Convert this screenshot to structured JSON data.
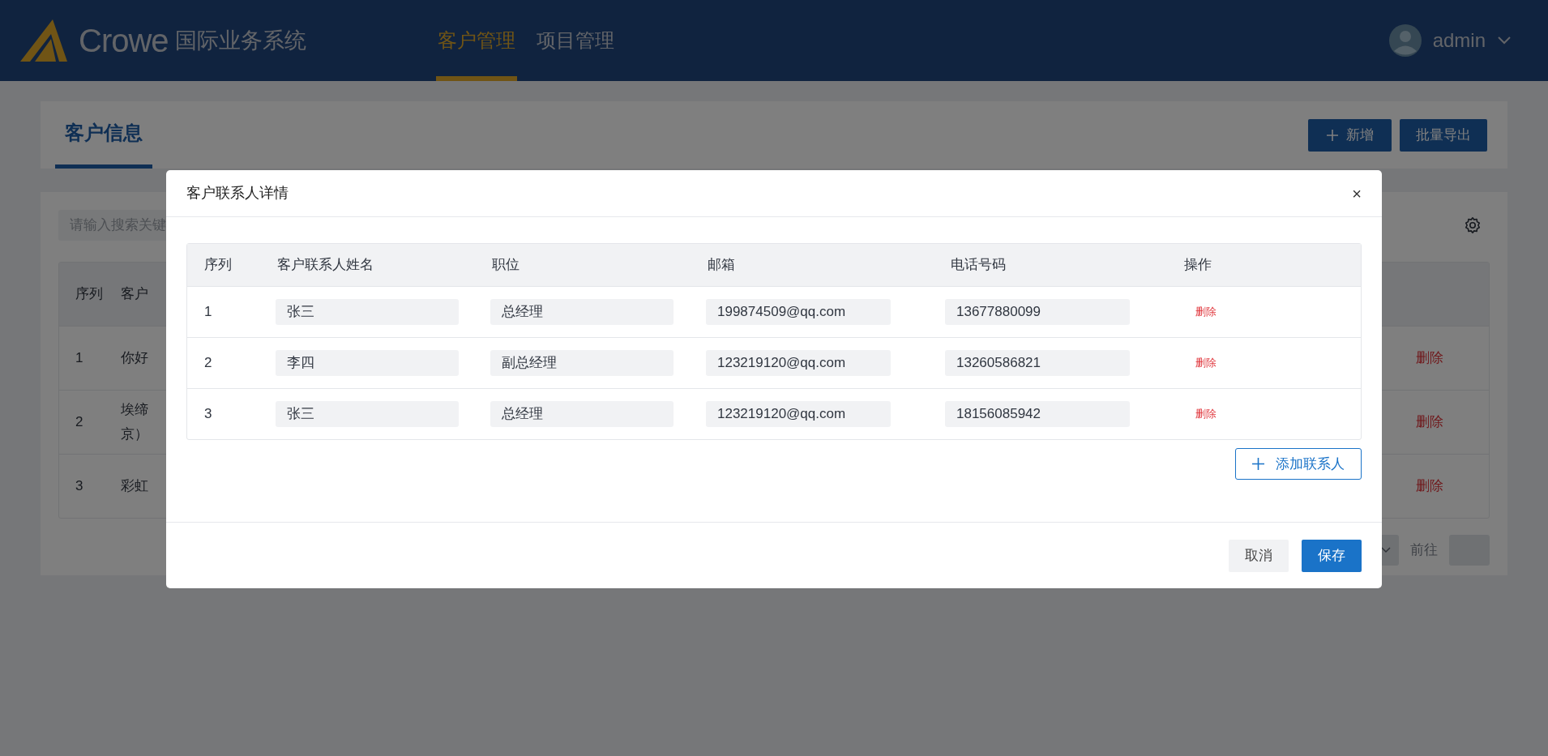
{
  "header": {
    "logo_text": "Crowe",
    "system_name": "国际业务系统",
    "nav": [
      {
        "label": "客户管理",
        "selected": true
      },
      {
        "label": "项目管理",
        "selected": false
      }
    ],
    "user": {
      "name": "admin"
    }
  },
  "page": {
    "title": "客户信息",
    "buttons": [
      {
        "label": "新增",
        "kind": "add"
      },
      {
        "label": "批量导出",
        "kind": "plain"
      }
    ],
    "search": {
      "placeholder": "请输入搜索关键"
    },
    "table": {
      "columns": [
        "序列",
        "客户"
      ],
      "rows": [
        {
          "index": "1",
          "column_2": [
            "你好"
          ],
          "action": "删除"
        },
        {
          "index": "2",
          "column_2": [
            "埃缔",
            "京）"
          ],
          "action": "删除"
        },
        {
          "index": "3",
          "column_2": [
            "彩虹"
          ],
          "action": "删除"
        }
      ]
    },
    "pagination": {
      "goto_label": "前往"
    }
  },
  "modal": {
    "title": "客户联系人详情",
    "close": "×",
    "columns": [
      "序列",
      "客户联系人姓名",
      "职位",
      "邮箱",
      "电话号码",
      "操作"
    ],
    "rows": [
      {
        "index": "1",
        "name": "张三",
        "position": "总经理",
        "email": "199874509@qq.com",
        "phone": "13677880099",
        "action": "删除"
      },
      {
        "index": "2",
        "name": "李四",
        "position": "副总经理",
        "email": "123219120@qq.com",
        "phone": "13260586821",
        "action": "删除"
      },
      {
        "index": "3",
        "name": "张三",
        "position": "总经理",
        "email": "123219120@qq.com",
        "phone": "18156085942",
        "action": "删除"
      }
    ],
    "add_button": "添加联系人",
    "buttons": [
      {
        "label": "取消",
        "kind": "cancel"
      },
      {
        "label": "保存",
        "kind": "primary"
      }
    ]
  }
}
